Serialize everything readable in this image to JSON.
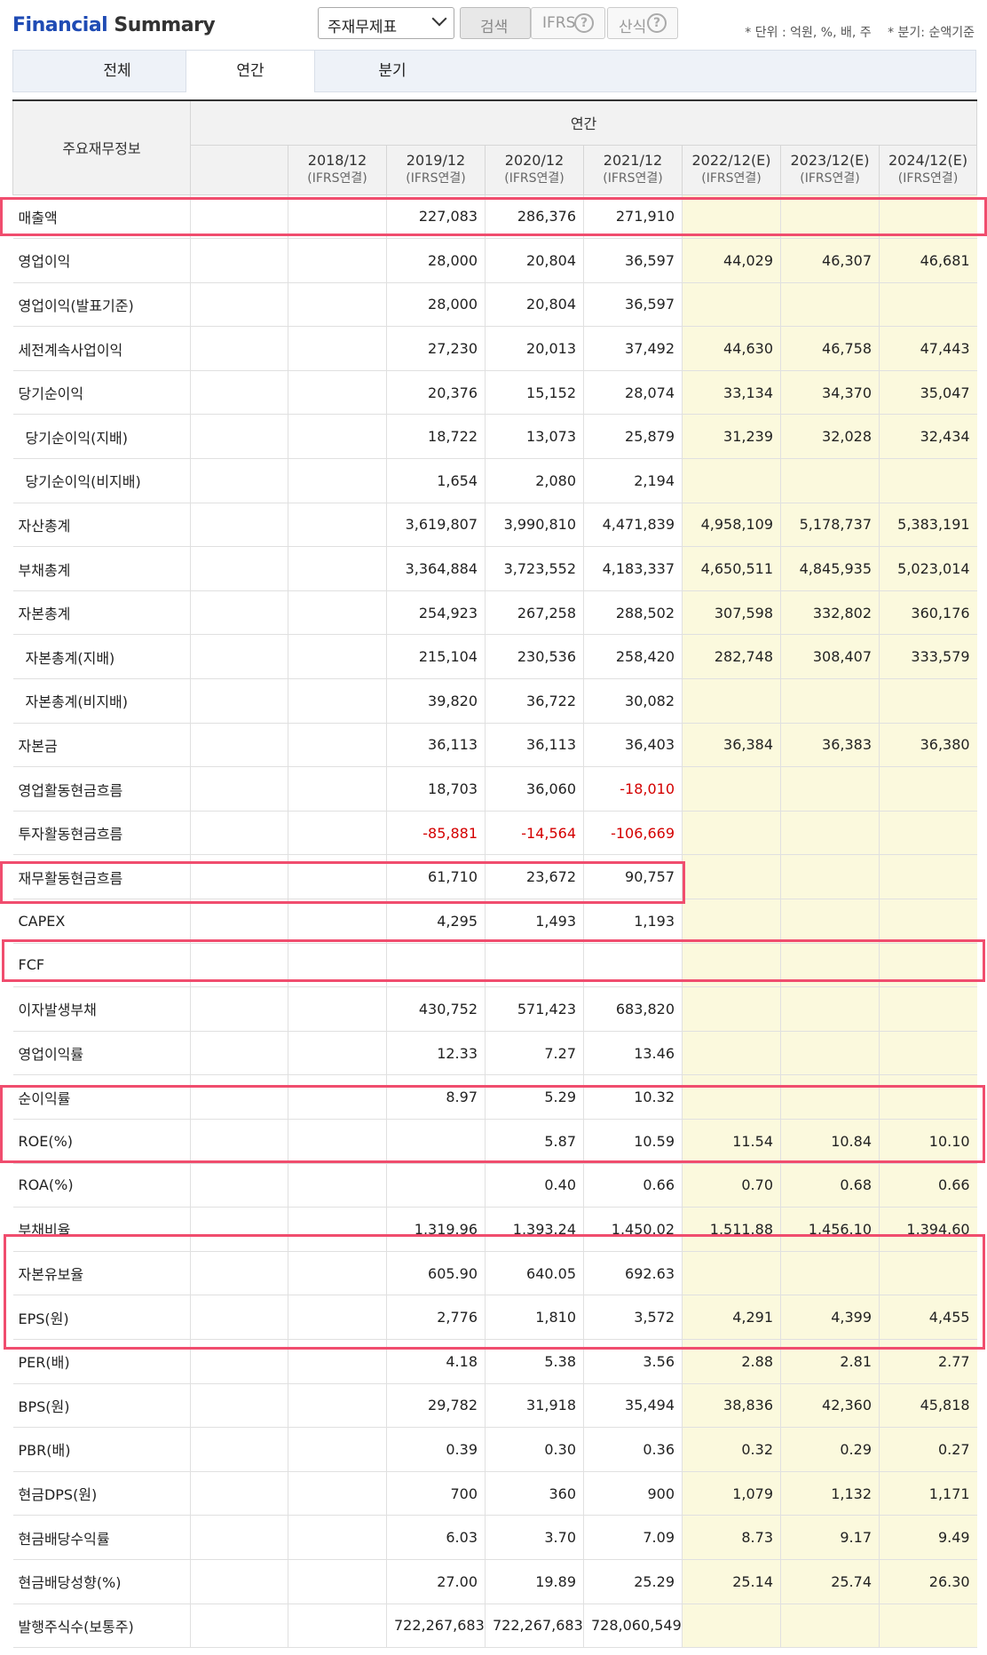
{
  "header": {
    "title_part1": "Financial",
    "title_part2": " Summary",
    "select_value": "주재무제표",
    "search_label": "검색",
    "ifrs_label": "IFRS",
    "formula_label": "산식",
    "help_icon_glyph": "?",
    "unit_note": "* 단위 : 억원, %, 배, 주",
    "quarter_note": "* 분기: 순액기준"
  },
  "tabs": [
    {
      "label": "전체",
      "active": false
    },
    {
      "label": "연간",
      "active": true
    },
    {
      "label": "분기",
      "active": false
    }
  ],
  "table": {
    "row_header": "주요재무정보",
    "group_header": "연간",
    "columns": [
      {
        "year": "2018/12",
        "basis": "(IFRS연결)",
        "estimate": false
      },
      {
        "year": "2019/12",
        "basis": "(IFRS연결)",
        "estimate": false
      },
      {
        "year": "2020/12",
        "basis": "(IFRS연결)",
        "estimate": false
      },
      {
        "year": "2021/12",
        "basis": "(IFRS연결)",
        "estimate": false
      },
      {
        "year": "2022/12(E)",
        "basis": "(IFRS연결)",
        "estimate": true
      },
      {
        "year": "2023/12(E)",
        "basis": "(IFRS연결)",
        "estimate": true
      },
      {
        "year": "2024/12(E)",
        "basis": "(IFRS연결)",
        "estimate": true
      }
    ],
    "rows": [
      {
        "label": "매출액",
        "indent": false,
        "values": [
          "",
          "227,083",
          "286,376",
          "271,910",
          "",
          "",
          ""
        ]
      },
      {
        "label": "영업이익",
        "indent": false,
        "values": [
          "",
          "28,000",
          "20,804",
          "36,597",
          "44,029",
          "46,307",
          "46,681"
        ]
      },
      {
        "label": "영업이익(발표기준)",
        "indent": false,
        "values": [
          "",
          "28,000",
          "20,804",
          "36,597",
          "",
          "",
          ""
        ]
      },
      {
        "label": "세전계속사업이익",
        "indent": false,
        "values": [
          "",
          "27,230",
          "20,013",
          "37,492",
          "44,630",
          "46,758",
          "47,443"
        ]
      },
      {
        "label": "당기순이익",
        "indent": false,
        "values": [
          "",
          "20,376",
          "15,152",
          "28,074",
          "33,134",
          "34,370",
          "35,047"
        ]
      },
      {
        "label": "당기순이익(지배)",
        "indent": true,
        "values": [
          "",
          "18,722",
          "13,073",
          "25,879",
          "31,239",
          "32,028",
          "32,434"
        ]
      },
      {
        "label": "당기순이익(비지배)",
        "indent": true,
        "values": [
          "",
          "1,654",
          "2,080",
          "2,194",
          "",
          "",
          ""
        ]
      },
      {
        "label": "자산총계",
        "indent": false,
        "values": [
          "",
          "3,619,807",
          "3,990,810",
          "4,471,839",
          "4,958,109",
          "5,178,737",
          "5,383,191"
        ]
      },
      {
        "label": "부채총계",
        "indent": false,
        "values": [
          "",
          "3,364,884",
          "3,723,552",
          "4,183,337",
          "4,650,511",
          "4,845,935",
          "5,023,014"
        ]
      },
      {
        "label": "자본총계",
        "indent": false,
        "values": [
          "",
          "254,923",
          "267,258",
          "288,502",
          "307,598",
          "332,802",
          "360,176"
        ]
      },
      {
        "label": "자본총계(지배)",
        "indent": true,
        "values": [
          "",
          "215,104",
          "230,536",
          "258,420",
          "282,748",
          "308,407",
          "333,579"
        ]
      },
      {
        "label": "자본총계(비지배)",
        "indent": true,
        "values": [
          "",
          "39,820",
          "36,722",
          "30,082",
          "",
          "",
          ""
        ]
      },
      {
        "label": "자본금",
        "indent": false,
        "values": [
          "",
          "36,113",
          "36,113",
          "36,403",
          "36,384",
          "36,383",
          "36,380"
        ]
      },
      {
        "label": "영업활동현금흐름",
        "indent": false,
        "values": [
          "",
          "18,703",
          "36,060",
          "-18,010",
          "",
          "",
          ""
        ]
      },
      {
        "label": "투자활동현금흐름",
        "indent": false,
        "values": [
          "",
          "-85,881",
          "-14,564",
          "-106,669",
          "",
          "",
          ""
        ]
      },
      {
        "label": "재무활동현금흐름",
        "indent": false,
        "values": [
          "",
          "61,710",
          "23,672",
          "90,757",
          "",
          "",
          ""
        ]
      },
      {
        "label": "CAPEX",
        "indent": false,
        "values": [
          "",
          "4,295",
          "1,493",
          "1,193",
          "",
          "",
          ""
        ]
      },
      {
        "label": "FCF",
        "indent": false,
        "values": [
          "",
          "",
          "",
          "",
          "",
          "",
          ""
        ]
      },
      {
        "label": "이자발생부채",
        "indent": false,
        "values": [
          "",
          "430,752",
          "571,423",
          "683,820",
          "",
          "",
          ""
        ]
      },
      {
        "label": "영업이익률",
        "indent": false,
        "values": [
          "",
          "12.33",
          "7.27",
          "13.46",
          "",
          "",
          ""
        ]
      },
      {
        "label": "순이익률",
        "indent": false,
        "values": [
          "",
          "8.97",
          "5.29",
          "10.32",
          "",
          "",
          ""
        ]
      },
      {
        "label": "ROE(%)",
        "indent": false,
        "values": [
          "",
          "",
          "5.87",
          "10.59",
          "11.54",
          "10.84",
          "10.10"
        ]
      },
      {
        "label": "ROA(%)",
        "indent": false,
        "values": [
          "",
          "",
          "0.40",
          "0.66",
          "0.70",
          "0.68",
          "0.66"
        ]
      },
      {
        "label": "부채비율",
        "indent": false,
        "values": [
          "",
          "1,319.96",
          "1,393.24",
          "1,450.02",
          "1,511.88",
          "1,456.10",
          "1,394.60"
        ]
      },
      {
        "label": "자본유보율",
        "indent": false,
        "values": [
          "",
          "605.90",
          "640.05",
          "692.63",
          "",
          "",
          ""
        ]
      },
      {
        "label": "EPS(원)",
        "indent": false,
        "values": [
          "",
          "2,776",
          "1,810",
          "3,572",
          "4,291",
          "4,399",
          "4,455"
        ]
      },
      {
        "label": "PER(배)",
        "indent": false,
        "values": [
          "",
          "4.18",
          "5.38",
          "3.56",
          "2.88",
          "2.81",
          "2.77"
        ]
      },
      {
        "label": "BPS(원)",
        "indent": false,
        "values": [
          "",
          "29,782",
          "31,918",
          "35,494",
          "38,836",
          "42,360",
          "45,818"
        ]
      },
      {
        "label": "PBR(배)",
        "indent": false,
        "values": [
          "",
          "0.39",
          "0.30",
          "0.36",
          "0.32",
          "0.29",
          "0.27"
        ]
      },
      {
        "label": "현금DPS(원)",
        "indent": false,
        "values": [
          "",
          "700",
          "360",
          "900",
          "1,079",
          "1,132",
          "1,171"
        ]
      },
      {
        "label": "현금배당수익률",
        "indent": false,
        "values": [
          "",
          "6.03",
          "3.70",
          "7.09",
          "8.73",
          "9.17",
          "9.49"
        ]
      },
      {
        "label": "현금배당성향(%)",
        "indent": false,
        "values": [
          "",
          "27.00",
          "19.89",
          "25.29",
          "25.14",
          "25.74",
          "26.30"
        ]
      },
      {
        "label": "발행주식수(보통주)",
        "indent": false,
        "values": [
          "",
          "722,267,683",
          "722,267,683",
          "728,060,549",
          "",
          "",
          ""
        ]
      }
    ]
  },
  "colors": {
    "title_blue": "#1f4bb4",
    "estimate_bg": "#fbf9dd",
    "negative": "#d40000",
    "highlight_box": "#f04d6e"
  }
}
